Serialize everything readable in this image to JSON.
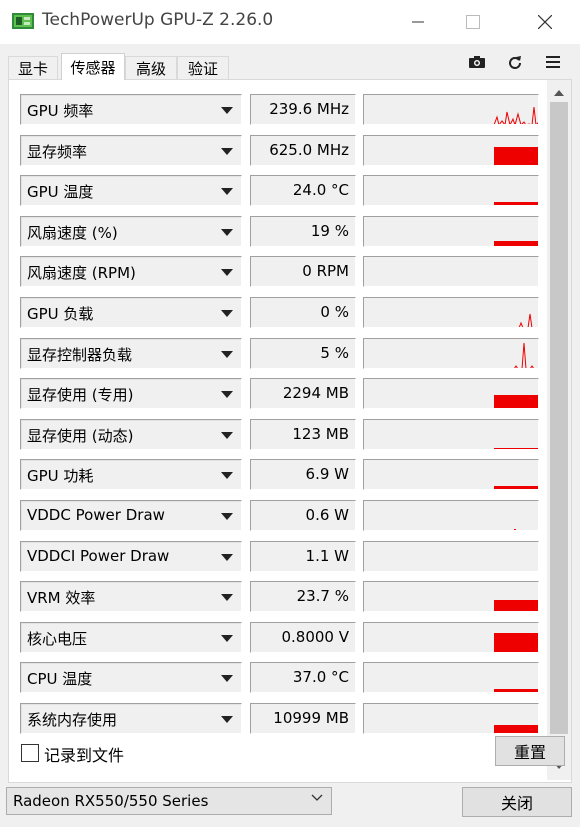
{
  "window": {
    "title": "TechPowerUp GPU-Z 2.26.0"
  },
  "tabs": [
    {
      "label": "显卡",
      "active": false
    },
    {
      "label": "传感器",
      "active": true
    },
    {
      "label": "高级",
      "active": false
    },
    {
      "label": "验证",
      "active": false
    }
  ],
  "toolbar": {
    "icons": [
      "camera-icon",
      "refresh-icon",
      "menu-icon"
    ]
  },
  "sensors": [
    {
      "name": "GPU 频率",
      "value": "239.6 MHz"
    },
    {
      "name": "显存频率",
      "value": "625.0 MHz"
    },
    {
      "name": "GPU 温度",
      "value": "24.0 °C"
    },
    {
      "name": "风扇速度 (%)",
      "value": "19 %"
    },
    {
      "name": "风扇速度 (RPM)",
      "value": "0 RPM"
    },
    {
      "name": "GPU 负载",
      "value": "0 %"
    },
    {
      "name": "显存控制器负载",
      "value": "5 %"
    },
    {
      "name": "显存使用 (专用)",
      "value": "2294 MB"
    },
    {
      "name": "显存使用 (动态)",
      "value": "123 MB"
    },
    {
      "name": "GPU 功耗",
      "value": "6.9 W"
    },
    {
      "name": "VDDC Power Draw",
      "value": "0.6 W"
    },
    {
      "name": "VDDCI Power Draw",
      "value": "1.1 W"
    },
    {
      "name": "VRM 效率",
      "value": "23.7 %"
    },
    {
      "name": "核心电压",
      "value": "0.8000 V"
    },
    {
      "name": "CPU 温度",
      "value": "37.0 °C"
    },
    {
      "name": "系统内存使用",
      "value": "10999 MB"
    }
  ],
  "graph_color": "#ee0000",
  "log_to_file": {
    "label": "记录到文件",
    "checked": false
  },
  "buttons": {
    "reset": "重置",
    "close": "关闭"
  },
  "gpu_select": {
    "value": "Radeon RX550/550 Series"
  }
}
